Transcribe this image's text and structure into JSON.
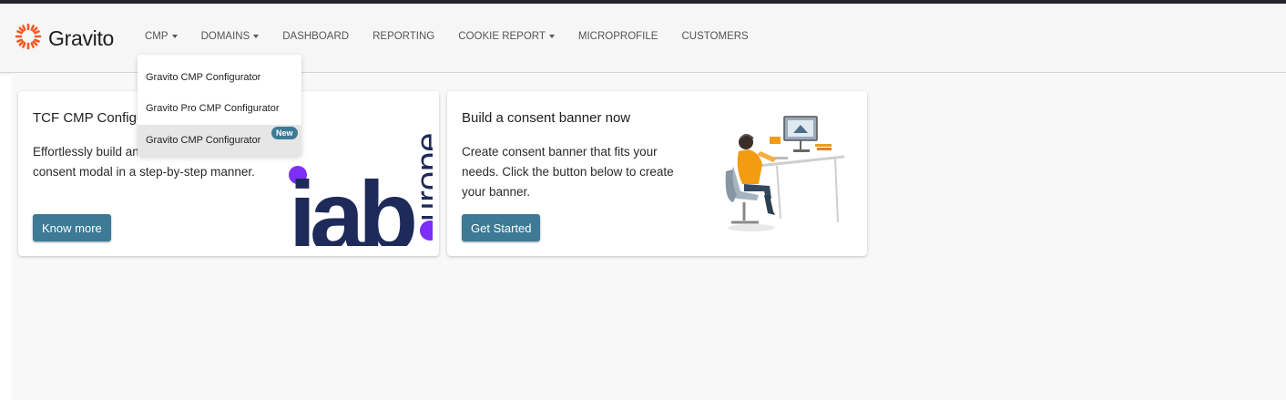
{
  "brand": {
    "name": "Gravito",
    "accent_color": "#f05a28"
  },
  "nav": {
    "items": [
      {
        "label": "CMP",
        "has_caret": true
      },
      {
        "label": "DOMAINS",
        "has_caret": true
      },
      {
        "label": "DASHBOARD",
        "has_caret": false
      },
      {
        "label": "REPORTING",
        "has_caret": false
      },
      {
        "label": "COOKIE REPORT",
        "has_caret": true
      },
      {
        "label": "MICROPROFILE",
        "has_caret": false
      },
      {
        "label": "CUSTOMERS",
        "has_caret": false
      }
    ]
  },
  "dropdown": {
    "items": [
      {
        "label": "Gravito CMP Configurator"
      },
      {
        "label": "Gravito Pro CMP Configurator"
      },
      {
        "label": "Gravito CMP Configurator",
        "badge": "New",
        "highlighted": true
      }
    ]
  },
  "cards": [
    {
      "title": "TCF CMP Configurator",
      "description": "Effortlessly build and customized TCF consent modal in a step-by-step manner.",
      "button_label": "Know more",
      "logo_text_main": "iab",
      "logo_text_secondary": "europe"
    },
    {
      "title": "Build a consent banner now",
      "description": "Create consent banner that fits your needs. Click the button below to create your banner.",
      "button_label": "Get Started"
    }
  ],
  "colors": {
    "button": "#3d7a96",
    "iab_navy": "#1e2a5a",
    "iab_purple": "#7b2ff7",
    "illustration_orange": "#f39c12"
  }
}
